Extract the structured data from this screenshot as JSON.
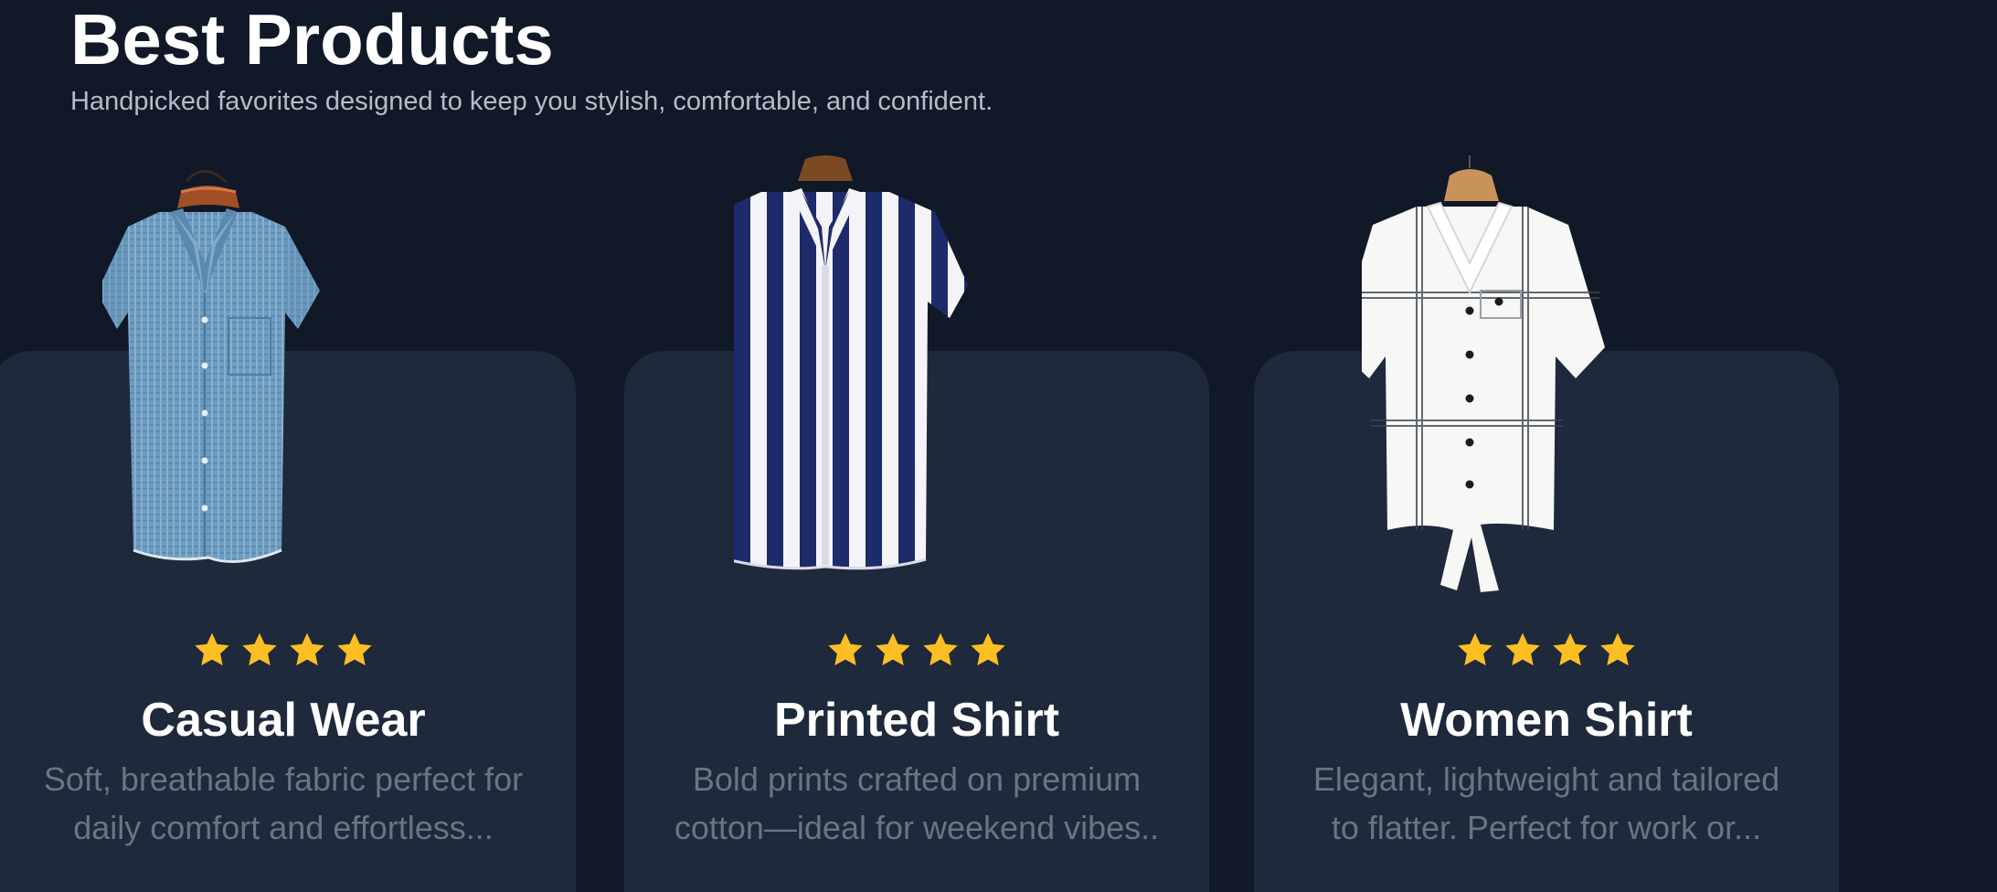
{
  "section": {
    "title": "Best Products",
    "subtitle": "Handpicked favorites designed to keep you stylish, comfortable, and confident."
  },
  "colors": {
    "background": "#111827",
    "card": "#1e293b",
    "star": "#fbbf24",
    "title": "#ffffff",
    "description": "#6b7483"
  },
  "products": [
    {
      "name": "Casual Wear",
      "rating": 4,
      "description_line1": "Soft, breathable fabric perfect for",
      "description_line2": "daily comfort and effortless...",
      "image_icon": "blue-textured-shirt-image"
    },
    {
      "name": "Printed Shirt",
      "rating": 4,
      "description_line1": "Bold prints crafted on premium",
      "description_line2": "cotton—ideal for weekend vibes..",
      "image_icon": "navy-striped-shirt-image"
    },
    {
      "name": "Women Shirt",
      "rating": 4,
      "description_line1": "Elegant, lightweight and tailored",
      "description_line2": "to flatter. Perfect for work or...",
      "image_icon": "white-plaid-tie-shirt-image"
    }
  ]
}
